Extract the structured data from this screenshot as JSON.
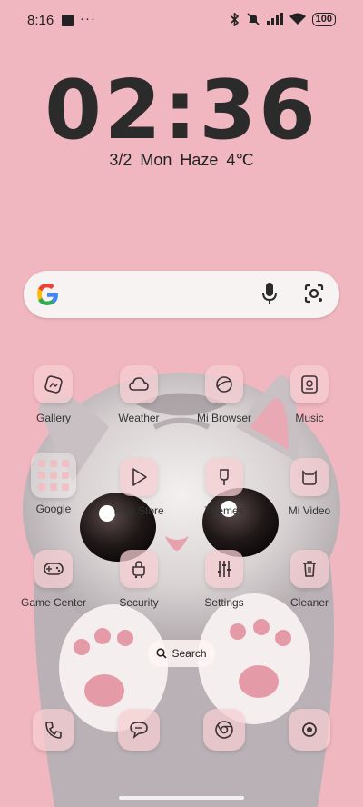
{
  "status": {
    "time": "8:16",
    "dots": "···",
    "battery": "100"
  },
  "clock": {
    "time": "02:36",
    "date": "3/2 Mon Haze 4℃"
  },
  "apps": [
    {
      "label": "Gallery"
    },
    {
      "label": "Weather"
    },
    {
      "label": "Mi Browser"
    },
    {
      "label": "Music"
    },
    {
      "label": "Google"
    },
    {
      "label": "Play Store"
    },
    {
      "label": "Themes"
    },
    {
      "label": "Mi Video"
    },
    {
      "label": "Game Center"
    },
    {
      "label": "Security"
    },
    {
      "label": "Settings"
    },
    {
      "label": "Cleaner"
    }
  ],
  "search_pill": "Search",
  "dock": [
    "phone-icon",
    "messages-icon",
    "chrome-icon",
    "camera-icon"
  ],
  "icons": {
    "accent": "#f1b7c0",
    "icon_stroke": "#3b3133"
  }
}
